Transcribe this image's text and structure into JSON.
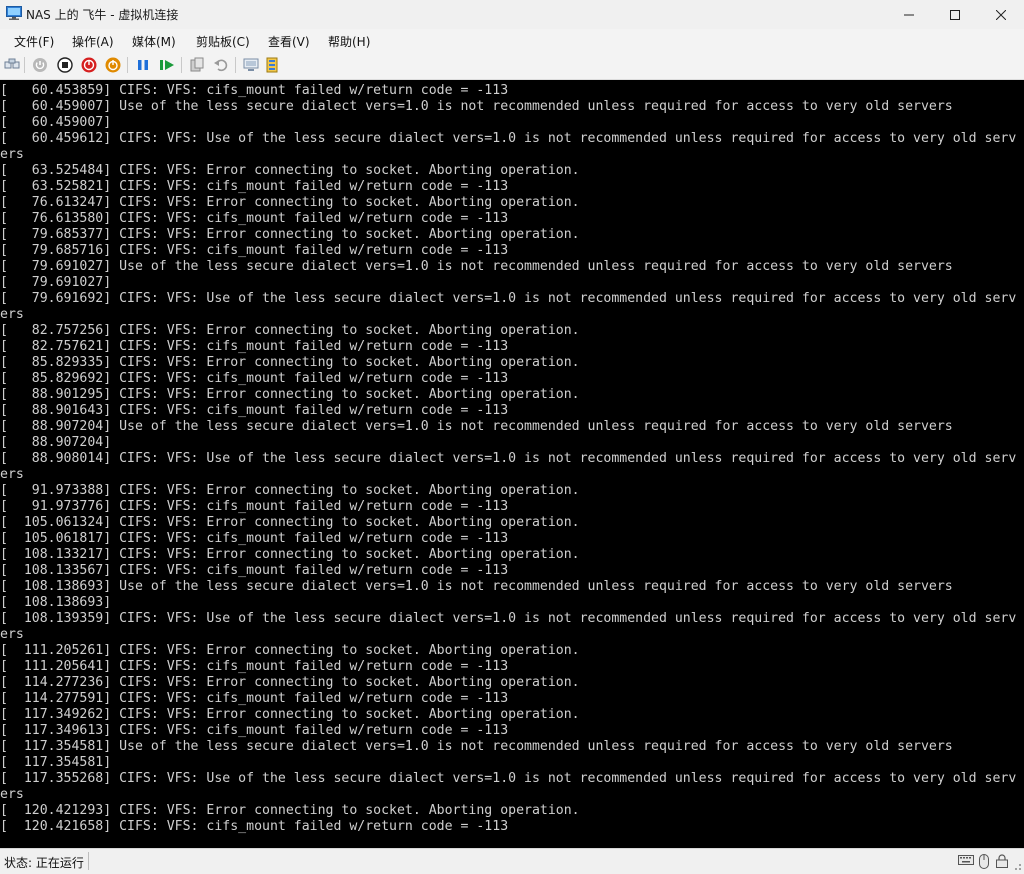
{
  "window": {
    "title": "NAS 上的 飞牛 - 虚拟机连接"
  },
  "menu": [
    "文件(F)",
    "操作(A)",
    "媒体(M)",
    "剪贴板(C)",
    "查看(V)",
    "帮助(H)"
  ],
  "status": {
    "text": "状态: 正在运行"
  },
  "console": {
    "lines": [
      "[   60.453859] CIFS: VFS: cifs_mount failed w/return code = -113",
      "[   60.459007] Use of the less secure dialect vers=1.0 is not recommended unless required for access to very old servers",
      "[   60.459007]",
      "[   60.459612] CIFS: VFS: Use of the less secure dialect vers=1.0 is not recommended unless required for access to very old serv",
      "ers",
      "[   63.525484] CIFS: VFS: Error connecting to socket. Aborting operation.",
      "[   63.525821] CIFS: VFS: cifs_mount failed w/return code = -113",
      "[   76.613247] CIFS: VFS: Error connecting to socket. Aborting operation.",
      "[   76.613580] CIFS: VFS: cifs_mount failed w/return code = -113",
      "[   79.685377] CIFS: VFS: Error connecting to socket. Aborting operation.",
      "[   79.685716] CIFS: VFS: cifs_mount failed w/return code = -113",
      "[   79.691027] Use of the less secure dialect vers=1.0 is not recommended unless required for access to very old servers",
      "[   79.691027]",
      "[   79.691692] CIFS: VFS: Use of the less secure dialect vers=1.0 is not recommended unless required for access to very old serv",
      "ers",
      "[   82.757256] CIFS: VFS: Error connecting to socket. Aborting operation.",
      "[   82.757621] CIFS: VFS: cifs_mount failed w/return code = -113",
      "[   85.829335] CIFS: VFS: Error connecting to socket. Aborting operation.",
      "[   85.829692] CIFS: VFS: cifs_mount failed w/return code = -113",
      "[   88.901295] CIFS: VFS: Error connecting to socket. Aborting operation.",
      "[   88.901643] CIFS: VFS: cifs_mount failed w/return code = -113",
      "[   88.907204] Use of the less secure dialect vers=1.0 is not recommended unless required for access to very old servers",
      "[   88.907204]",
      "[   88.908014] CIFS: VFS: Use of the less secure dialect vers=1.0 is not recommended unless required for access to very old serv",
      "ers",
      "[   91.973388] CIFS: VFS: Error connecting to socket. Aborting operation.",
      "[   91.973776] CIFS: VFS: cifs_mount failed w/return code = -113",
      "[  105.061324] CIFS: VFS: Error connecting to socket. Aborting operation.",
      "[  105.061817] CIFS: VFS: cifs_mount failed w/return code = -113",
      "[  108.133217] CIFS: VFS: Error connecting to socket. Aborting operation.",
      "[  108.133567] CIFS: VFS: cifs_mount failed w/return code = -113",
      "[  108.138693] Use of the less secure dialect vers=1.0 is not recommended unless required for access to very old servers",
      "[  108.138693]",
      "[  108.139359] CIFS: VFS: Use of the less secure dialect vers=1.0 is not recommended unless required for access to very old serv",
      "ers",
      "[  111.205261] CIFS: VFS: Error connecting to socket. Aborting operation.",
      "[  111.205641] CIFS: VFS: cifs_mount failed w/return code = -113",
      "[  114.277236] CIFS: VFS: Error connecting to socket. Aborting operation.",
      "[  114.277591] CIFS: VFS: cifs_mount failed w/return code = -113",
      "[  117.349262] CIFS: VFS: Error connecting to socket. Aborting operation.",
      "[  117.349613] CIFS: VFS: cifs_mount failed w/return code = -113",
      "[  117.354581] Use of the less secure dialect vers=1.0 is not recommended unless required for access to very old servers",
      "[  117.354581]",
      "[  117.355268] CIFS: VFS: Use of the less secure dialect vers=1.0 is not recommended unless required for access to very old serv",
      "ers",
      "[  120.421293] CIFS: VFS: Error connecting to socket. Aborting operation.",
      "[  120.421658] CIFS: VFS: cifs_mount failed w/return code = -113",
      "_"
    ]
  },
  "icons": {
    "toolbar": [
      "ctrl-alt-del-icon",
      "start-icon",
      "turn-off-icon",
      "shut-down-icon",
      "save-icon",
      "pause-icon",
      "resume-icon",
      "checkpoint-icon",
      "revert-icon",
      "enhanced-session-icon",
      "share-icon"
    ],
    "status": [
      "keyboard-icon",
      "mouse-icon",
      "lock-icon"
    ]
  },
  "colors": {
    "console_bg": "#000000",
    "console_fg": "#cfcfcf",
    "stop": "#d61f1f",
    "power": "#e08a00",
    "play": "#1a9a3a",
    "pause": "#1e6fd9"
  }
}
